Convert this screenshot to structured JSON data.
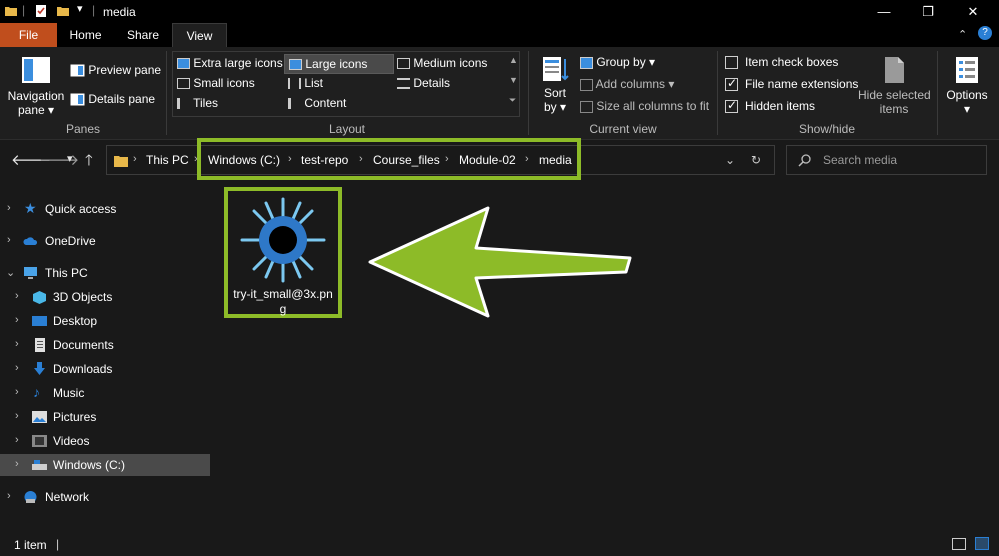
{
  "window": {
    "title": "media"
  },
  "tabs": {
    "file": "File",
    "home": "Home",
    "share": "Share",
    "view": "View"
  },
  "ribbon": {
    "panes": {
      "navigation_pane_line1": "Navigation",
      "navigation_pane_line2": "pane",
      "preview_pane": "Preview pane",
      "details_pane": "Details pane",
      "group_label": "Panes"
    },
    "layout": {
      "extra_large_icons": "Extra large icons",
      "large_icons": "Large icons",
      "medium_icons": "Medium icons",
      "small_icons": "Small icons",
      "list": "List",
      "details": "Details",
      "tiles": "Tiles",
      "content": "Content",
      "group_label": "Layout",
      "selected": "Large icons"
    },
    "current_view": {
      "sort_by_line1": "Sort",
      "sort_by_line2": "by",
      "group_by": "Group by",
      "add_columns": "Add columns",
      "size_all_columns": "Size all columns to fit",
      "group_label": "Current view"
    },
    "show_hide": {
      "item_check_boxes": "Item check boxes",
      "item_check_boxes_checked": false,
      "file_name_extensions": "File name extensions",
      "file_name_extensions_checked": true,
      "hidden_items": "Hidden items",
      "hidden_items_checked": true,
      "hide_selected_line1": "Hide selected",
      "hide_selected_line2": "items",
      "group_label": "Show/hide"
    },
    "options": "Options"
  },
  "address": {
    "crumbs": [
      "This PC",
      "Windows (C:)",
      "test-repo",
      "Course_files",
      "Module-02",
      "media"
    ]
  },
  "search": {
    "placeholder": "Search media"
  },
  "sidebar": {
    "items": [
      {
        "label": "Quick access",
        "icon": "star-icon"
      },
      {
        "label": "OneDrive",
        "icon": "cloud-icon"
      },
      {
        "label": "This PC",
        "icon": "computer-icon"
      },
      {
        "label": "3D Objects",
        "icon": "cube-icon"
      },
      {
        "label": "Desktop",
        "icon": "desktop-icon"
      },
      {
        "label": "Documents",
        "icon": "document-icon"
      },
      {
        "label": "Downloads",
        "icon": "download-icon"
      },
      {
        "label": "Music",
        "icon": "music-icon"
      },
      {
        "label": "Pictures",
        "icon": "picture-icon"
      },
      {
        "label": "Videos",
        "icon": "video-icon"
      },
      {
        "label": "Windows (C:)",
        "icon": "drive-icon"
      },
      {
        "label": "Network",
        "icon": "network-icon"
      }
    ]
  },
  "files": [
    {
      "name": "try-it_small@3x.png"
    }
  ],
  "status": {
    "count": "1 item"
  },
  "colors": {
    "accent_highlight": "#8dbb28",
    "file_tab": "#c04e1d",
    "selected_sidebar": "#4a4a4a"
  }
}
